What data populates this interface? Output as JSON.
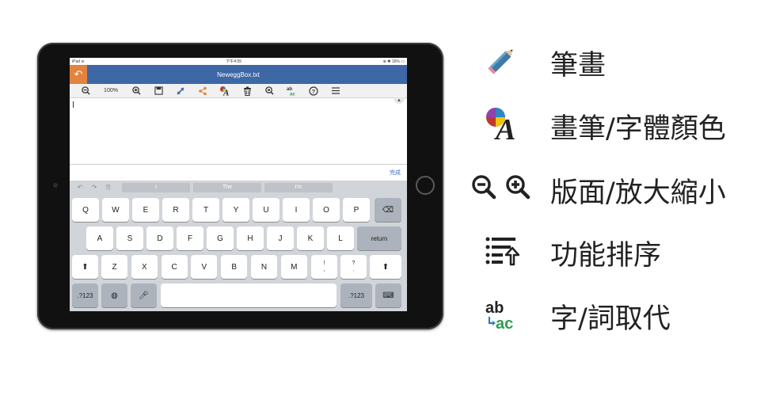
{
  "device": {
    "status": {
      "left": "iPad ≋",
      "center": "下午4:55",
      "right": "⊕ ✱ 16% ▭"
    },
    "title": "NeweggBox.txt",
    "toolbar": {
      "zoom": "100%",
      "icons": [
        "zoom-out-icon",
        "zoom-in-icon",
        "save-icon",
        "resize-icon",
        "share-icon",
        "font-color-icon",
        "trash-icon",
        "search-icon",
        "replace-icon",
        "help-icon",
        "menu-icon"
      ]
    },
    "helper_done": "完成",
    "suggestions": [
      "I",
      "The",
      "I'm"
    ],
    "keyboard": {
      "row1": [
        "Q",
        "W",
        "E",
        "R",
        "T",
        "Y",
        "U",
        "I",
        "O",
        "P"
      ],
      "row2": [
        "A",
        "S",
        "D",
        "F",
        "G",
        "H",
        "J",
        "K",
        "L"
      ],
      "row2_return": "return",
      "row3": [
        "Z",
        "X",
        "C",
        "V",
        "B",
        "N",
        "M"
      ],
      "row3_p1_top": "!",
      "row3_p1_bottom": ",",
      "row3_p2_top": "?",
      "row3_p2_bottom": ".",
      "numbers_left": ".?123",
      "numbers_right": ".?123"
    }
  },
  "legend": [
    {
      "icon": "pencil-icon",
      "label": "筆畫"
    },
    {
      "icon": "font-color-icon",
      "label": "畫筆/字體顏色"
    },
    {
      "icon": "zoom-out-zoom-in-icons",
      "label": "版面/放大縮小"
    },
    {
      "icon": "menu-sort-icon",
      "label": "功能排序"
    },
    {
      "icon": "replace-icon",
      "label": "字/詞取代"
    }
  ],
  "legend_replace_glyph": {
    "top": "ab",
    "bottom": "ac"
  },
  "colors": {
    "accent_blue": "#3d67a5",
    "back_orange": "#e3833d",
    "pencil_blue": "#3e7aa6"
  }
}
